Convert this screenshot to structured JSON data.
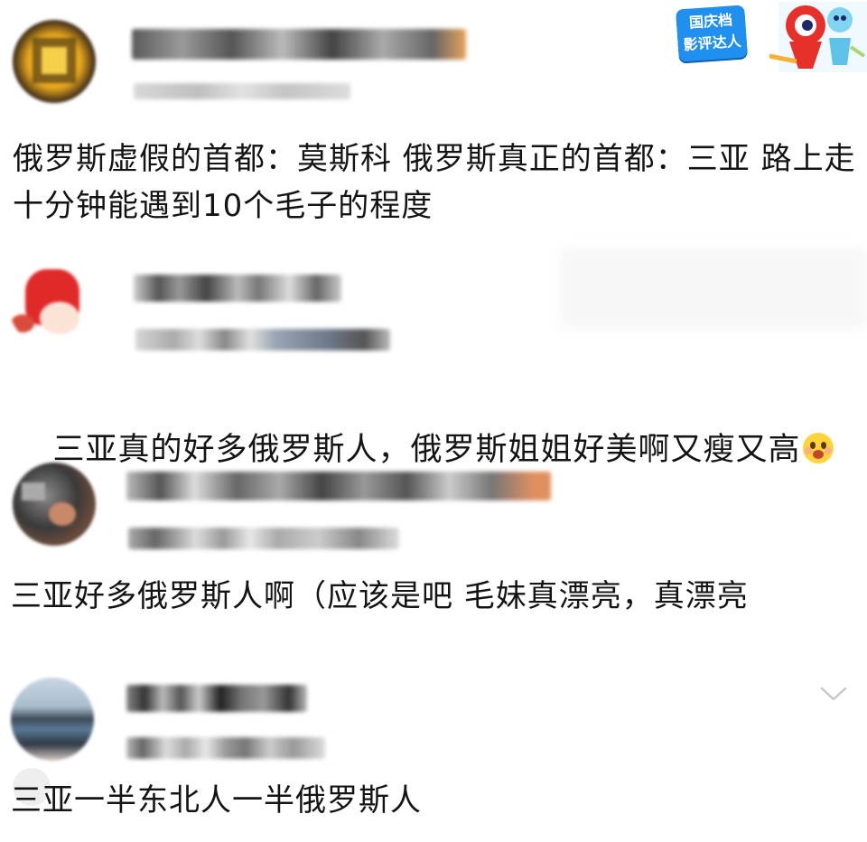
{
  "comments": [
    {
      "text": "俄罗斯虚假的首都：莫斯科 俄罗斯真正的首都：三亚 路上走十分钟能遇到10个毛子的程度"
    },
    {
      "text": "三亚真的好多俄罗斯人，俄罗斯姐姐好美啊又瘦又高"
    },
    {
      "text": "三亚好多俄罗斯人啊（应该是吧 毛妹真漂亮，真漂亮"
    },
    {
      "text": "三亚一半东北人一半俄罗斯人"
    }
  ],
  "badge": {
    "line1": "国庆档",
    "line2": "影评达人"
  },
  "colors": {
    "badge_blue": "#1f8ff0",
    "mascot_red": "#e8302a"
  },
  "icons": [
    "blurred-avatar",
    "emoji-icon",
    "chevron-down-icon"
  ]
}
